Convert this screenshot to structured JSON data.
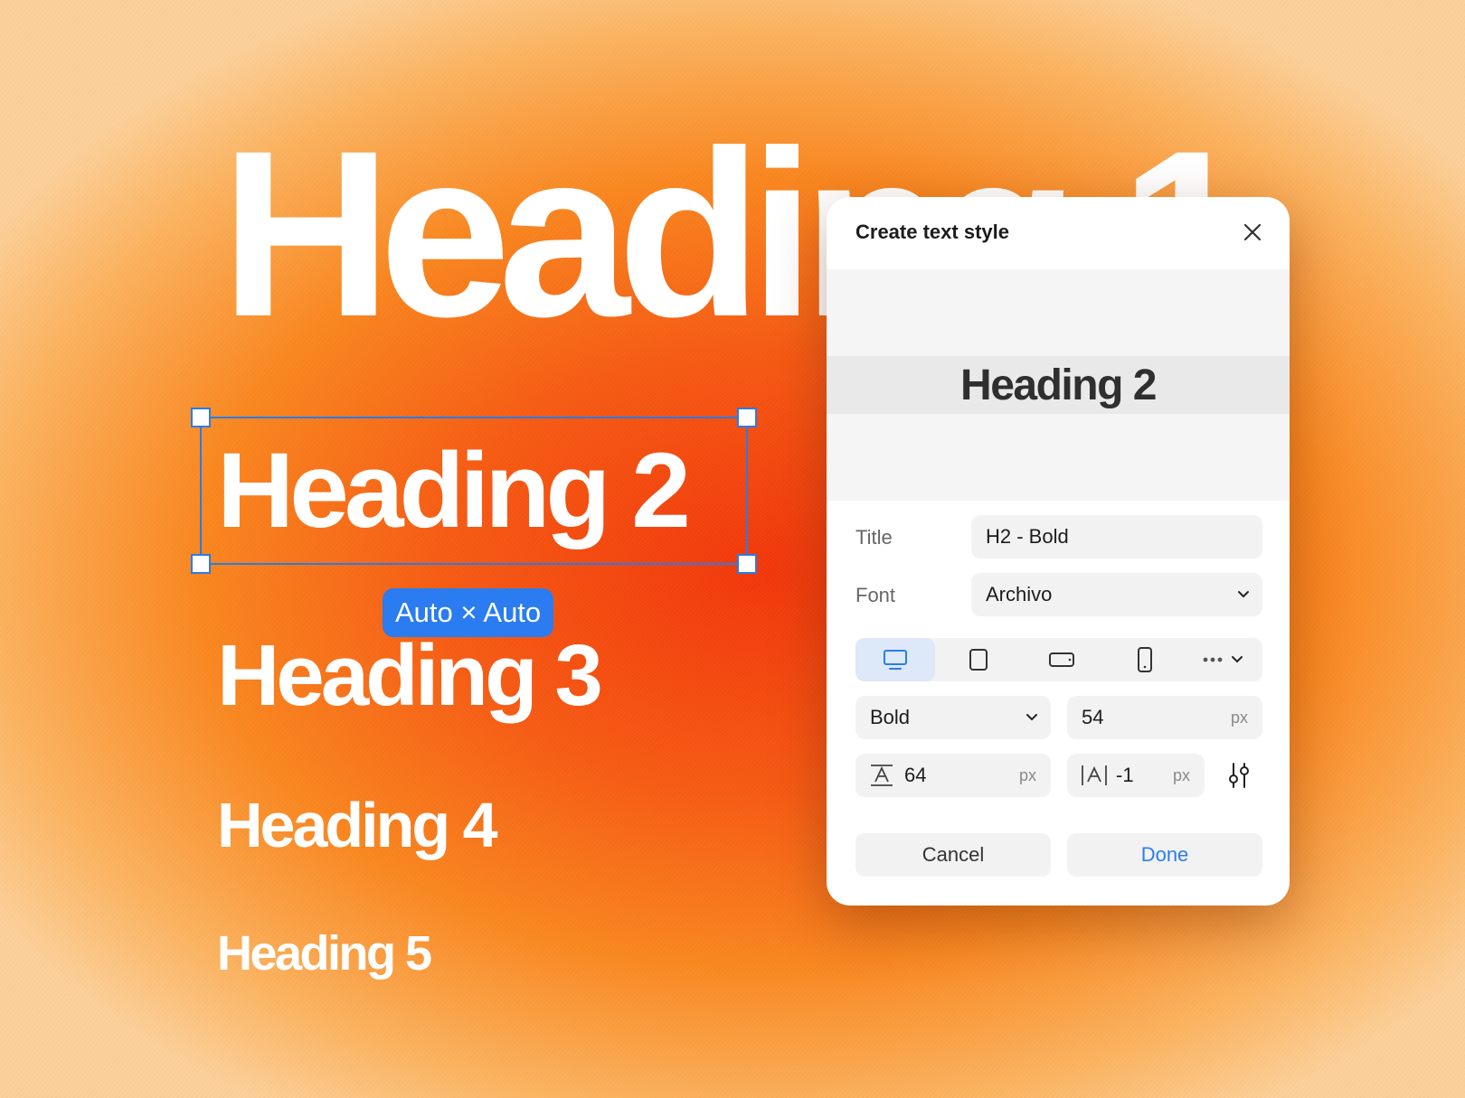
{
  "canvas": {
    "headings": {
      "h1": "Heading 1",
      "h2": "Heading 2",
      "h3": "Heading 3",
      "h4": "Heading 4",
      "h5": "Heading 5"
    },
    "size_badge": "Auto × Auto"
  },
  "dialog": {
    "title": "Create text style",
    "preview_text": "Heading 2",
    "title_label": "Title",
    "title_value": "H2 - Bold",
    "font_label": "Font",
    "font_value": "Archivo",
    "devices": [
      "desktop-icon",
      "tablet-icon",
      "tablet-landscape-icon",
      "phone-icon",
      "more-icon"
    ],
    "active_device": "desktop",
    "weight_value": "Bold",
    "font_size_value": "54",
    "font_size_unit": "px",
    "line_height_value": "64",
    "line_height_unit": "px",
    "letter_spacing_value": "-1",
    "letter_spacing_unit": "px",
    "cancel_label": "Cancel",
    "done_label": "Done"
  },
  "colors": {
    "accent": "#2a7cf0",
    "background_center": "#f2360a",
    "background_edge": "#fccf98"
  }
}
